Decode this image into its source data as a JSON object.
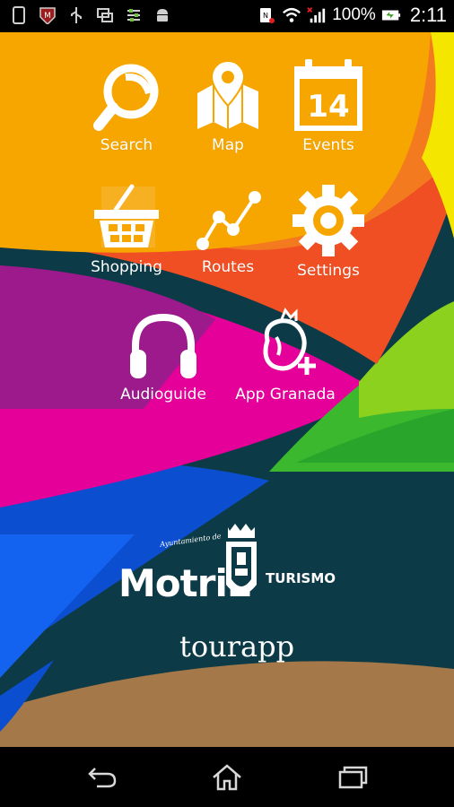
{
  "status_bar": {
    "battery_percent": "100%",
    "time": "2:11",
    "left_icons": [
      "phone-icon",
      "mcafee-icon",
      "usb-icon",
      "screen-share-icon",
      "settings-sliders-icon",
      "android-icon"
    ],
    "right_icons": [
      "nfc-icon",
      "wifi-icon",
      "signal-icon",
      "battery-icon"
    ]
  },
  "menu": {
    "search": "Search",
    "map": "Map",
    "events": "Events",
    "events_day": "14",
    "shopping": "Shopping",
    "routes": "Routes",
    "settings": "Settings",
    "audioguide": "Audioguide",
    "app_granada": "App Granada"
  },
  "branding": {
    "ayuntamiento": "Ayuntamiento de",
    "motril": "MotriL",
    "turismo": "TURISMO",
    "tourapp": "tourapp"
  },
  "colors": {
    "orange": "#F7A600",
    "dark_teal": "#0C3B47",
    "brown": "#A57849",
    "magenta": "#E6009A",
    "blue": "#0B4FD0",
    "green": "#3CB82E",
    "red": "#F04E23",
    "yellow": "#F5E600"
  },
  "nav_bar": {
    "icons": [
      "back-icon",
      "home-icon",
      "recent-apps-icon"
    ]
  }
}
